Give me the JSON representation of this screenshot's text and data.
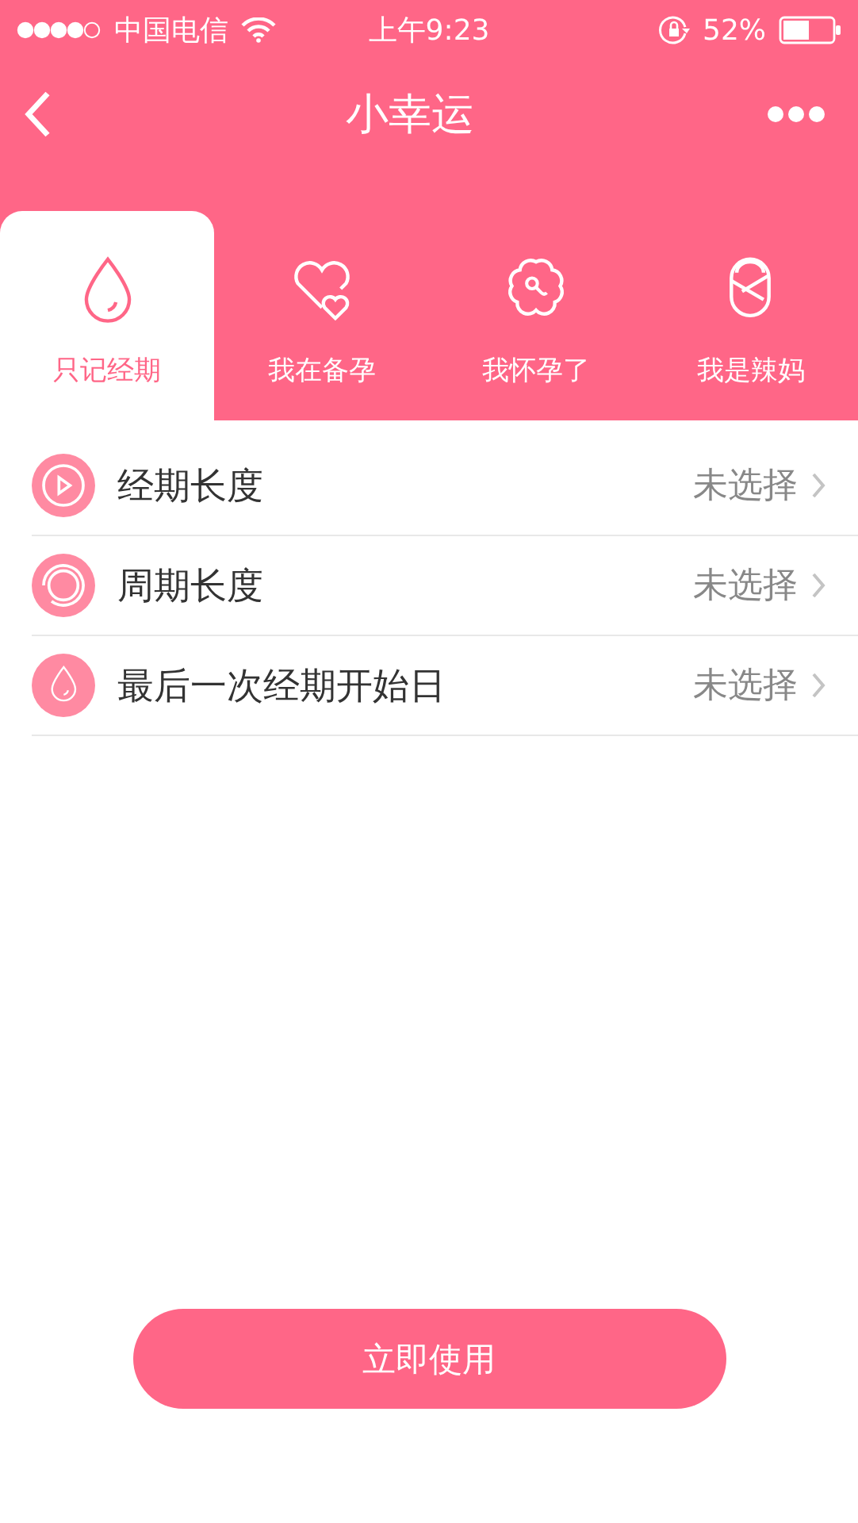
{
  "status_bar": {
    "carrier": "中国电信",
    "time": "上午9:23",
    "battery": "52%"
  },
  "nav": {
    "title": "小幸运"
  },
  "tabs": [
    {
      "label": "只记经期",
      "kind": "drop",
      "selected": true
    },
    {
      "label": "我在备孕",
      "kind": "hearts",
      "selected": false
    },
    {
      "label": "我怀孕了",
      "kind": "flower",
      "selected": false
    },
    {
      "label": "我是辣妈",
      "kind": "baby",
      "selected": false
    }
  ],
  "settings": [
    {
      "label": "经期长度",
      "kind": "play",
      "value": "未选择"
    },
    {
      "label": "周期长度",
      "kind": "ring",
      "value": "未选择"
    },
    {
      "label": "最后一次经期开始日",
      "kind": "drop",
      "value": "未选择"
    }
  ],
  "button": {
    "label": "立即使用"
  }
}
